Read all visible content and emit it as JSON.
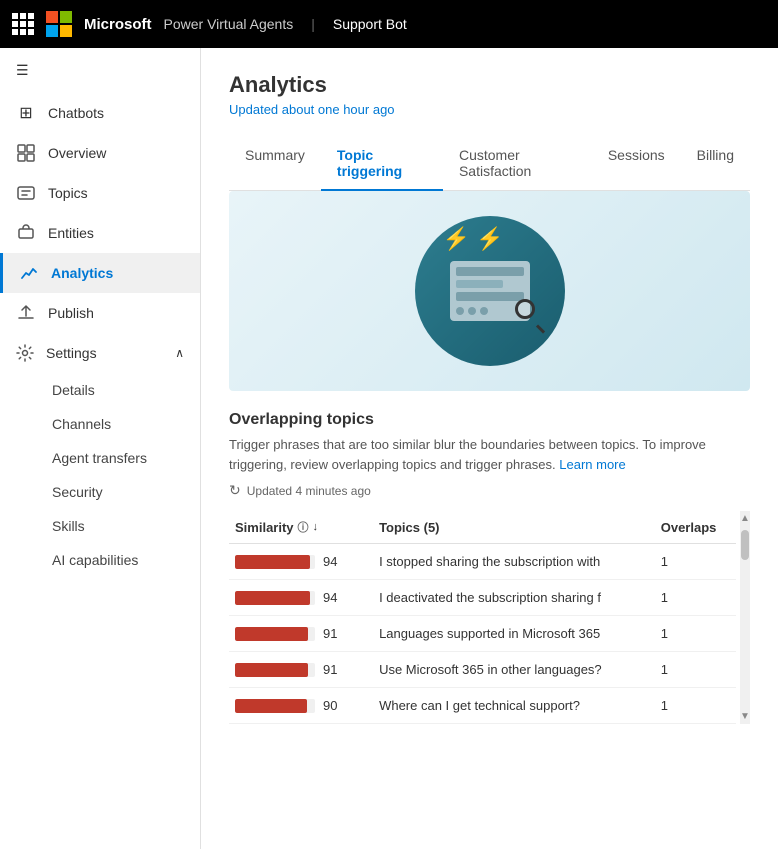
{
  "topnav": {
    "company": "Microsoft",
    "product": "Power Virtual Agents",
    "separator": "|",
    "bot": "Support Bot"
  },
  "sidebar": {
    "hamburger_icon": "☰",
    "items": [
      {
        "id": "chatbots",
        "label": "Chatbots",
        "icon": "⊞"
      },
      {
        "id": "overview",
        "label": "Overview",
        "icon": "⊡"
      },
      {
        "id": "topics",
        "label": "Topics",
        "icon": "💬"
      },
      {
        "id": "entities",
        "label": "Entities",
        "icon": "⊞"
      },
      {
        "id": "analytics",
        "label": "Analytics",
        "icon": "📈",
        "active": true
      },
      {
        "id": "publish",
        "label": "Publish",
        "icon": "⬆"
      },
      {
        "id": "settings",
        "label": "Settings",
        "icon": "⚙",
        "expanded": true
      }
    ],
    "settings_children": [
      {
        "id": "details",
        "label": "Details"
      },
      {
        "id": "channels",
        "label": "Channels"
      },
      {
        "id": "agent-transfers",
        "label": "Agent transfers"
      },
      {
        "id": "security",
        "label": "Security"
      },
      {
        "id": "skills",
        "label": "Skills"
      },
      {
        "id": "ai-capabilities",
        "label": "AI capabilities"
      }
    ]
  },
  "main": {
    "title": "Analytics",
    "subtitle": "Updated about one hour ago",
    "tabs": [
      {
        "id": "summary",
        "label": "Summary"
      },
      {
        "id": "topic-triggering",
        "label": "Topic triggering",
        "active": true
      },
      {
        "id": "customer-satisfaction",
        "label": "Customer Satisfaction"
      },
      {
        "id": "sessions",
        "label": "Sessions"
      },
      {
        "id": "billing",
        "label": "Billing"
      }
    ],
    "section": {
      "title": "Overlapping topics",
      "description": "Trigger phrases that are too similar blur the boundaries between topics. To improve triggering, review overlapping topics and trigger phrases.",
      "learn_more": "Learn more",
      "updated": "Updated 4 minutes ago"
    },
    "table": {
      "columns": [
        {
          "id": "similarity",
          "label": "Similarity"
        },
        {
          "id": "topics",
          "label": "Topics (5)"
        },
        {
          "id": "overlaps",
          "label": "Overlaps"
        }
      ],
      "rows": [
        {
          "similarity": 94,
          "bar_pct": 94,
          "topic": "I stopped sharing the subscription with",
          "overlaps": 1
        },
        {
          "similarity": 94,
          "bar_pct": 94,
          "topic": "I deactivated the subscription sharing f",
          "overlaps": 1
        },
        {
          "similarity": 91,
          "bar_pct": 91,
          "topic": "Languages supported in Microsoft 365",
          "overlaps": 1
        },
        {
          "similarity": 91,
          "bar_pct": 91,
          "topic": "Use Microsoft 365 in other languages?",
          "overlaps": 1
        },
        {
          "similarity": 90,
          "bar_pct": 90,
          "topic": "Where can I get technical support?",
          "overlaps": 1
        }
      ]
    }
  }
}
